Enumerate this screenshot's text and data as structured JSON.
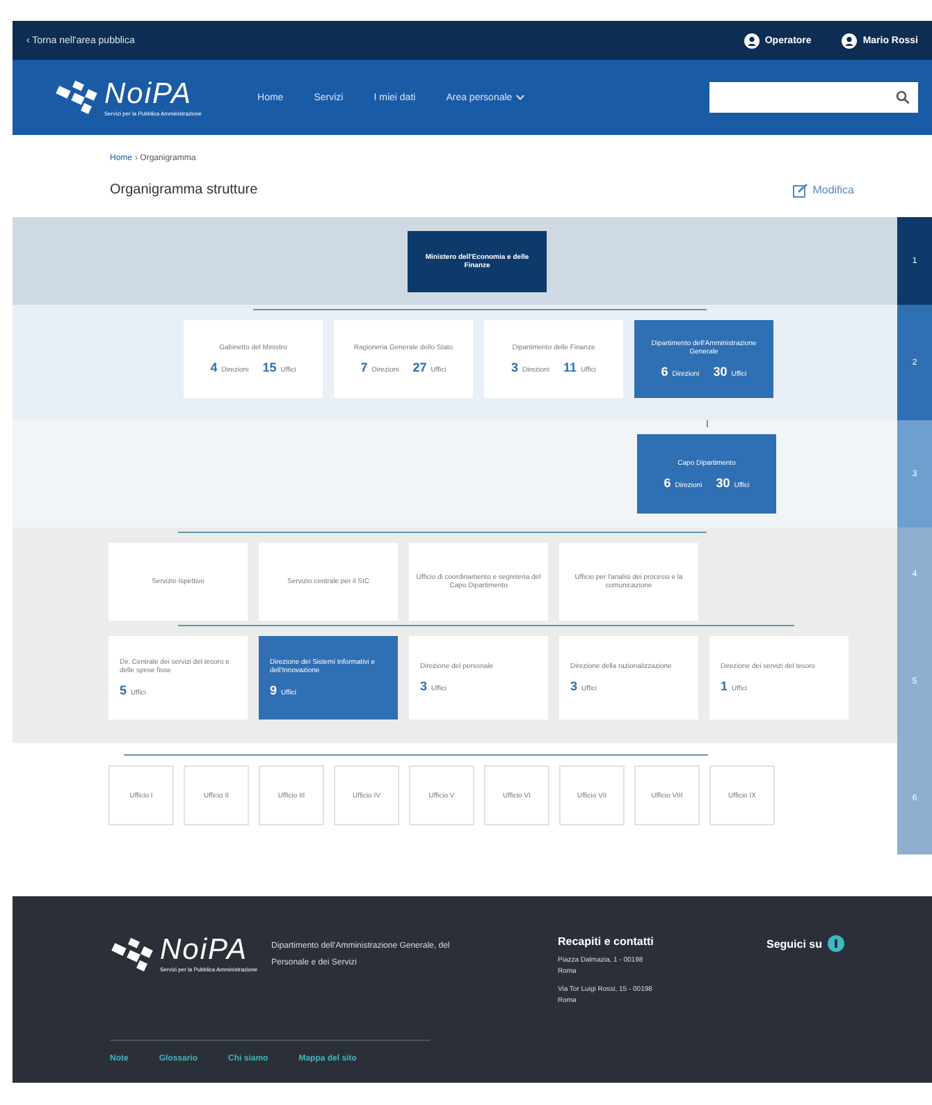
{
  "top_bar": {
    "back_link": "‹ Torna nell'area pubblica",
    "profile": "Operatore",
    "user": "Mario Rossi"
  },
  "header": {
    "logo": "NoiPA",
    "logo_tagline": "Servizi per la Pubblica Amministrazione",
    "nav": [
      {
        "label": "Home",
        "dropdown": false
      },
      {
        "label": "Servizi",
        "dropdown": false
      },
      {
        "label": "I miei dati",
        "dropdown": false
      },
      {
        "label": "Area personale",
        "dropdown": true
      }
    ]
  },
  "breadcrumb": [
    "Home",
    "› Organigramma"
  ],
  "page_title": "Organigramma strutture",
  "edit_button": "Modifica",
  "levels": [
    {
      "marker": "1",
      "boxes": [
        {
          "label": "Ministero dell'Economia e delle Finanze",
          "selected": true,
          "kind": "root"
        }
      ]
    },
    {
      "marker": "2",
      "boxes": [
        {
          "label": "Gabinetto del Ministro",
          "selected": false,
          "kind": "unit",
          "stats": [
            {
              "value": "4",
              "unit": "Direzioni"
            },
            {
              "value": "15",
              "unit": "Uffici"
            }
          ]
        },
        {
          "label": "Ragioneria Generale dello Stato",
          "selected": false,
          "kind": "unit",
          "stats": [
            {
              "value": "7",
              "unit": "Direzioni"
            },
            {
              "value": "27",
              "unit": "Uffici"
            }
          ]
        },
        {
          "label": "Dipartimento delle Finanze",
          "selected": false,
          "kind": "unit",
          "stats": [
            {
              "value": "3",
              "unit": "Direzioni"
            },
            {
              "value": "11",
              "unit": "Uffici"
            }
          ]
        },
        {
          "label": "Dipartimento dell'Amministrazione Generale",
          "selected": true,
          "kind": "unit",
          "stats": [
            {
              "value": "6",
              "unit": "Direzioni"
            },
            {
              "value": "30",
              "unit": "Uffici"
            }
          ]
        }
      ]
    },
    {
      "marker": "3",
      "boxes": [
        {
          "label": "Capo Dipartimento",
          "selected": true,
          "kind": "unit",
          "stats": [
            {
              "value": "6",
              "unit": "Direzioni"
            },
            {
              "value": "30",
              "unit": "Uffici"
            }
          ]
        }
      ]
    },
    {
      "marker": "4",
      "boxes": [
        {
          "label": "Servizio Ispettivo",
          "selected": false,
          "kind": "unit"
        },
        {
          "label": "Servizio centrale per il SIC",
          "selected": false,
          "kind": "unit"
        },
        {
          "label": "Ufficio di coordinamento e segreteria del Capo Dipartimento",
          "selected": false,
          "kind": "unit"
        },
        {
          "label": "Ufficio per l'analisi dei processi e la comunicazione",
          "selected": false,
          "kind": "unit"
        }
      ]
    },
    {
      "marker": "5",
      "boxes": [
        {
          "label": "Dir. Centrale dei servizi del tesoro e delle spese fisse",
          "selected": false,
          "kind": "unit",
          "stats": [
            {
              "value": "5",
              "unit": "Uffici"
            }
          ]
        },
        {
          "label": "Direzione dei Sistemi Informativi e dell'Innovazione",
          "selected": true,
          "kind": "unit",
          "stats": [
            {
              "value": "9",
              "unit": "Uffici"
            }
          ]
        },
        {
          "label": "Direzione del personale",
          "selected": false,
          "kind": "unit",
          "stats": [
            {
              "value": "3",
              "unit": "Uffici"
            }
          ]
        },
        {
          "label": "Direzione della razionalizzazione",
          "selected": false,
          "kind": "unit",
          "stats": [
            {
              "value": "3",
              "unit": "Uffici"
            }
          ]
        },
        {
          "label": "Direzione dei servizi del tesoro",
          "selected": false,
          "kind": "unit",
          "stats": [
            {
              "value": "1",
              "unit": "Uffici"
            }
          ]
        }
      ]
    },
    {
      "marker": "6",
      "boxes": [
        {
          "label": "Ufficio I",
          "selected": false,
          "kind": "office"
        },
        {
          "label": "Ufficio II",
          "selected": false,
          "kind": "office"
        },
        {
          "label": "Ufficio III",
          "selected": false,
          "kind": "office"
        },
        {
          "label": "Ufficio IV",
          "selected": false,
          "kind": "office"
        },
        {
          "label": "Ufficio V",
          "selected": false,
          "kind": "office"
        },
        {
          "label": "Ufficio VI",
          "selected": false,
          "kind": "office"
        },
        {
          "label": "Ufficio VII",
          "selected": false,
          "kind": "office"
        },
        {
          "label": "Ufficio VIII",
          "selected": false,
          "kind": "office"
        },
        {
          "label": "Ufficio IX",
          "selected": false,
          "kind": "office"
        }
      ]
    }
  ],
  "footer": {
    "logo": "NoiPA",
    "logo_tagline": "Servizi per la Pubblica Amministrazione",
    "department": "Dipartimento dell'Amministrazione Generale, del Personale e dei Servizi",
    "contacts_title": "Recapiti e contatti",
    "address": "Piazza Dalmazia, 1 - 00198 Roma",
    "address_2": "Via Tor Luigi Rossi, 15 - 00198 Roma",
    "follow": "Seguici su",
    "links": [
      "Note",
      "Glossario",
      "Chi siamo",
      "Mappa del sito"
    ]
  }
}
